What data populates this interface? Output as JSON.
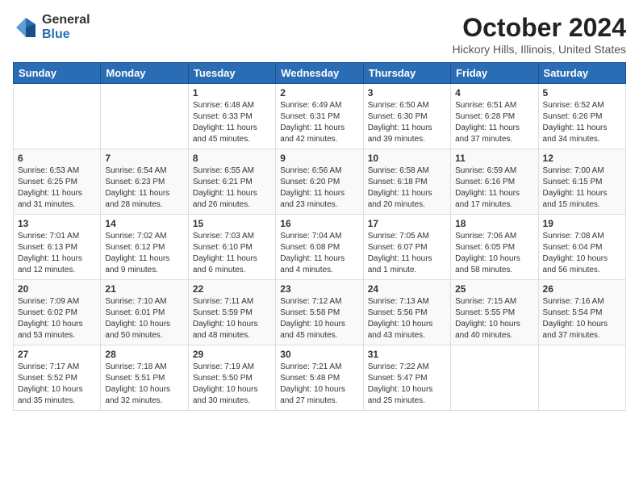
{
  "header": {
    "logo_general": "General",
    "logo_blue": "Blue",
    "month": "October 2024",
    "location": "Hickory Hills, Illinois, United States"
  },
  "weekdays": [
    "Sunday",
    "Monday",
    "Tuesday",
    "Wednesday",
    "Thursday",
    "Friday",
    "Saturday"
  ],
  "weeks": [
    [
      {
        "day": "",
        "sunrise": "",
        "sunset": "",
        "daylight": ""
      },
      {
        "day": "",
        "sunrise": "",
        "sunset": "",
        "daylight": ""
      },
      {
        "day": "1",
        "sunrise": "Sunrise: 6:48 AM",
        "sunset": "Sunset: 6:33 PM",
        "daylight": "Daylight: 11 hours and 45 minutes."
      },
      {
        "day": "2",
        "sunrise": "Sunrise: 6:49 AM",
        "sunset": "Sunset: 6:31 PM",
        "daylight": "Daylight: 11 hours and 42 minutes."
      },
      {
        "day": "3",
        "sunrise": "Sunrise: 6:50 AM",
        "sunset": "Sunset: 6:30 PM",
        "daylight": "Daylight: 11 hours and 39 minutes."
      },
      {
        "day": "4",
        "sunrise": "Sunrise: 6:51 AM",
        "sunset": "Sunset: 6:28 PM",
        "daylight": "Daylight: 11 hours and 37 minutes."
      },
      {
        "day": "5",
        "sunrise": "Sunrise: 6:52 AM",
        "sunset": "Sunset: 6:26 PM",
        "daylight": "Daylight: 11 hours and 34 minutes."
      }
    ],
    [
      {
        "day": "6",
        "sunrise": "Sunrise: 6:53 AM",
        "sunset": "Sunset: 6:25 PM",
        "daylight": "Daylight: 11 hours and 31 minutes."
      },
      {
        "day": "7",
        "sunrise": "Sunrise: 6:54 AM",
        "sunset": "Sunset: 6:23 PM",
        "daylight": "Daylight: 11 hours and 28 minutes."
      },
      {
        "day": "8",
        "sunrise": "Sunrise: 6:55 AM",
        "sunset": "Sunset: 6:21 PM",
        "daylight": "Daylight: 11 hours and 26 minutes."
      },
      {
        "day": "9",
        "sunrise": "Sunrise: 6:56 AM",
        "sunset": "Sunset: 6:20 PM",
        "daylight": "Daylight: 11 hours and 23 minutes."
      },
      {
        "day": "10",
        "sunrise": "Sunrise: 6:58 AM",
        "sunset": "Sunset: 6:18 PM",
        "daylight": "Daylight: 11 hours and 20 minutes."
      },
      {
        "day": "11",
        "sunrise": "Sunrise: 6:59 AM",
        "sunset": "Sunset: 6:16 PM",
        "daylight": "Daylight: 11 hours and 17 minutes."
      },
      {
        "day": "12",
        "sunrise": "Sunrise: 7:00 AM",
        "sunset": "Sunset: 6:15 PM",
        "daylight": "Daylight: 11 hours and 15 minutes."
      }
    ],
    [
      {
        "day": "13",
        "sunrise": "Sunrise: 7:01 AM",
        "sunset": "Sunset: 6:13 PM",
        "daylight": "Daylight: 11 hours and 12 minutes."
      },
      {
        "day": "14",
        "sunrise": "Sunrise: 7:02 AM",
        "sunset": "Sunset: 6:12 PM",
        "daylight": "Daylight: 11 hours and 9 minutes."
      },
      {
        "day": "15",
        "sunrise": "Sunrise: 7:03 AM",
        "sunset": "Sunset: 6:10 PM",
        "daylight": "Daylight: 11 hours and 6 minutes."
      },
      {
        "day": "16",
        "sunrise": "Sunrise: 7:04 AM",
        "sunset": "Sunset: 6:08 PM",
        "daylight": "Daylight: 11 hours and 4 minutes."
      },
      {
        "day": "17",
        "sunrise": "Sunrise: 7:05 AM",
        "sunset": "Sunset: 6:07 PM",
        "daylight": "Daylight: 11 hours and 1 minute."
      },
      {
        "day": "18",
        "sunrise": "Sunrise: 7:06 AM",
        "sunset": "Sunset: 6:05 PM",
        "daylight": "Daylight: 10 hours and 58 minutes."
      },
      {
        "day": "19",
        "sunrise": "Sunrise: 7:08 AM",
        "sunset": "Sunset: 6:04 PM",
        "daylight": "Daylight: 10 hours and 56 minutes."
      }
    ],
    [
      {
        "day": "20",
        "sunrise": "Sunrise: 7:09 AM",
        "sunset": "Sunset: 6:02 PM",
        "daylight": "Daylight: 10 hours and 53 minutes."
      },
      {
        "day": "21",
        "sunrise": "Sunrise: 7:10 AM",
        "sunset": "Sunset: 6:01 PM",
        "daylight": "Daylight: 10 hours and 50 minutes."
      },
      {
        "day": "22",
        "sunrise": "Sunrise: 7:11 AM",
        "sunset": "Sunset: 5:59 PM",
        "daylight": "Daylight: 10 hours and 48 minutes."
      },
      {
        "day": "23",
        "sunrise": "Sunrise: 7:12 AM",
        "sunset": "Sunset: 5:58 PM",
        "daylight": "Daylight: 10 hours and 45 minutes."
      },
      {
        "day": "24",
        "sunrise": "Sunrise: 7:13 AM",
        "sunset": "Sunset: 5:56 PM",
        "daylight": "Daylight: 10 hours and 43 minutes."
      },
      {
        "day": "25",
        "sunrise": "Sunrise: 7:15 AM",
        "sunset": "Sunset: 5:55 PM",
        "daylight": "Daylight: 10 hours and 40 minutes."
      },
      {
        "day": "26",
        "sunrise": "Sunrise: 7:16 AM",
        "sunset": "Sunset: 5:54 PM",
        "daylight": "Daylight: 10 hours and 37 minutes."
      }
    ],
    [
      {
        "day": "27",
        "sunrise": "Sunrise: 7:17 AM",
        "sunset": "Sunset: 5:52 PM",
        "daylight": "Daylight: 10 hours and 35 minutes."
      },
      {
        "day": "28",
        "sunrise": "Sunrise: 7:18 AM",
        "sunset": "Sunset: 5:51 PM",
        "daylight": "Daylight: 10 hours and 32 minutes."
      },
      {
        "day": "29",
        "sunrise": "Sunrise: 7:19 AM",
        "sunset": "Sunset: 5:50 PM",
        "daylight": "Daylight: 10 hours and 30 minutes."
      },
      {
        "day": "30",
        "sunrise": "Sunrise: 7:21 AM",
        "sunset": "Sunset: 5:48 PM",
        "daylight": "Daylight: 10 hours and 27 minutes."
      },
      {
        "day": "31",
        "sunrise": "Sunrise: 7:22 AM",
        "sunset": "Sunset: 5:47 PM",
        "daylight": "Daylight: 10 hours and 25 minutes."
      },
      {
        "day": "",
        "sunrise": "",
        "sunset": "",
        "daylight": ""
      },
      {
        "day": "",
        "sunrise": "",
        "sunset": "",
        "daylight": ""
      }
    ]
  ]
}
